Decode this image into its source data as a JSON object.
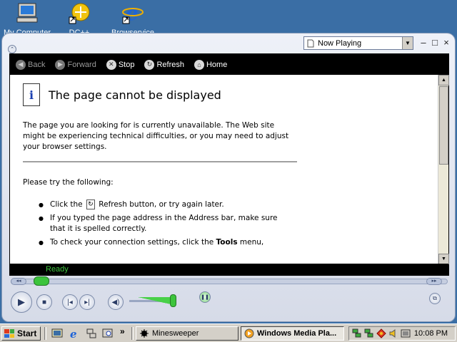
{
  "desktop": {
    "icons": [
      {
        "label": "My Computer",
        "icon": "computer-icon"
      },
      {
        "label": "DC++",
        "icon": "dcpp-icon"
      },
      {
        "label": "Browservice",
        "icon": "ie-icon"
      }
    ]
  },
  "wmp": {
    "now_playing_select": "Now Playing",
    "window_buttons": {
      "minimize": "–",
      "maximize": "□",
      "close": "×"
    },
    "nav": {
      "back": "Back",
      "forward": "Forward",
      "stop": "Stop",
      "refresh": "Refresh",
      "home": "Home"
    },
    "page": {
      "title": "The page cannot be displayed",
      "paragraph": "The page you are looking for is currently unavailable. The Web site might be experiencing technical difficulties, or you may need to adjust your browser settings.",
      "try_heading": "Please try the following:",
      "bullet1_pre": "Click the",
      "bullet1_post": "Refresh button, or try again later.",
      "bullet2": "If you typed the page address in the Address bar, make sure that it is spelled correctly.",
      "bullet3_pre": "To check your connection settings, click the",
      "bullet3_bold": "Tools",
      "bullet3_post": "menu,"
    },
    "status": "Ready",
    "colors": {
      "status_text": "#3ec43e",
      "nav_bg": "#000000",
      "accent_green": "#3cc43c"
    }
  },
  "taskbar": {
    "start_label": "Start",
    "more_glyph": "»",
    "tasks": [
      {
        "label": "Minesweeper",
        "active": false
      },
      {
        "label": "Windows Media Pla...",
        "active": true
      }
    ],
    "clock": "10:08 PM"
  }
}
